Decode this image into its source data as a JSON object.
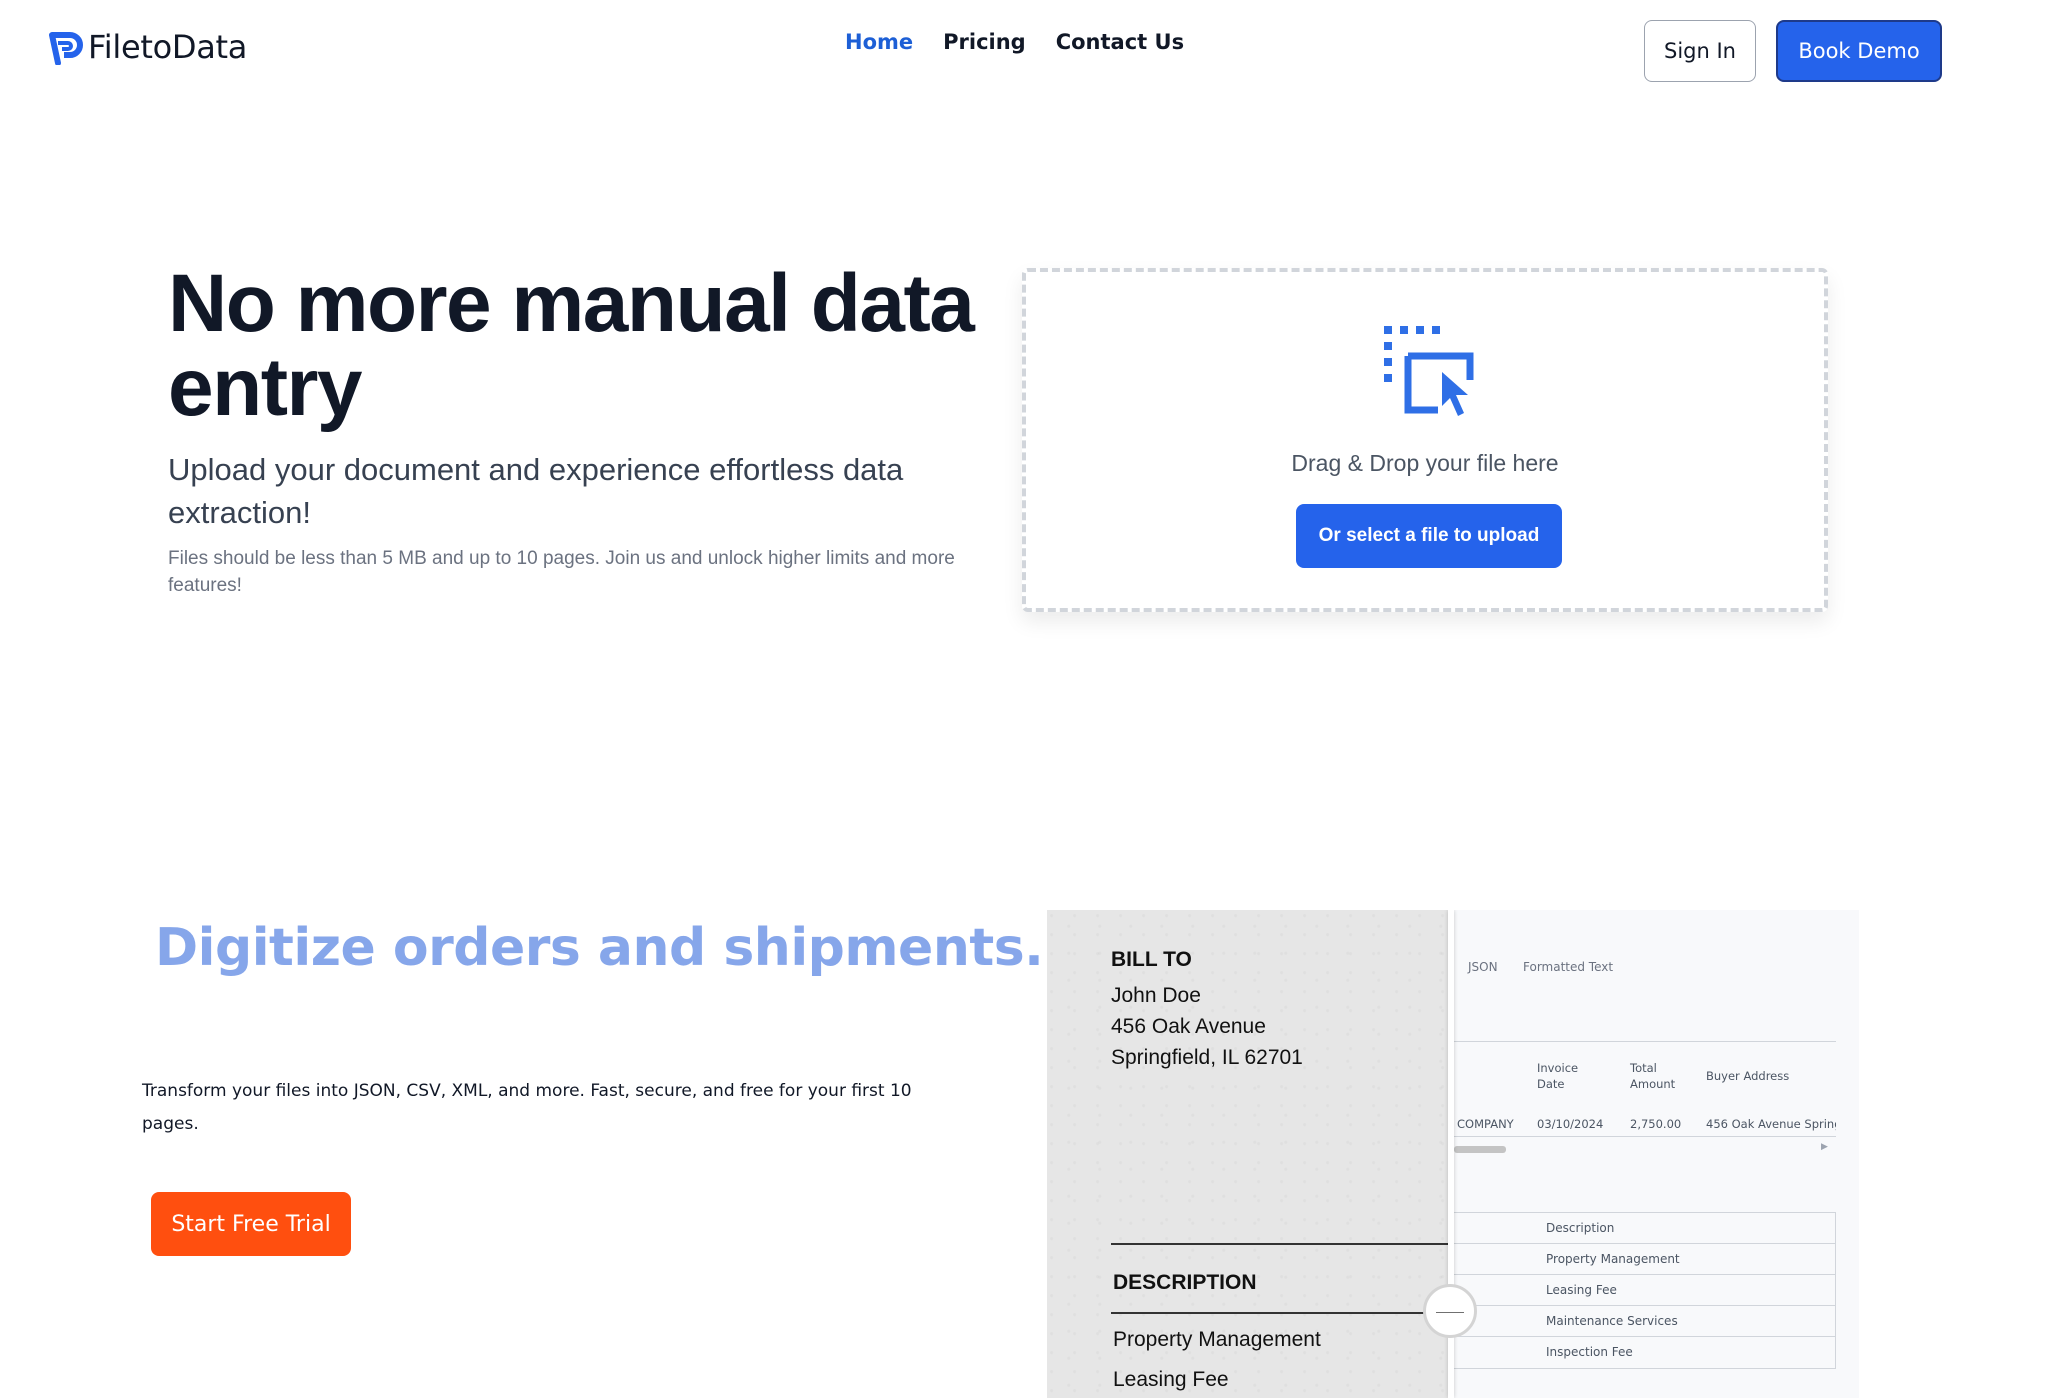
{
  "header": {
    "logo_text": "FiletoData",
    "nav": [
      {
        "label": "Home",
        "active": true
      },
      {
        "label": "Pricing",
        "active": false
      },
      {
        "label": "Contact Us",
        "active": false
      }
    ],
    "signin_label": "Sign In",
    "demo_label": "Book Demo"
  },
  "hero": {
    "title": "No more manual data entry",
    "subtitle": "Upload your document and experience effortless data extraction!",
    "note": "Files should be less than 5 MB and up to 10 pages. Join us and unlock higher limits and more features!",
    "drop_text": "Drag & Drop your file here",
    "upload_button": "Or select a file to upload",
    "drop_icon": "select-cursor-icon"
  },
  "digitize": {
    "title": "Digitize orders and shipments.",
    "description": "Transform your files into JSON, CSV, XML, and more. Fast, secure, and free for your first 10 pages.",
    "cta_label": "Start Free Trial"
  },
  "compare": {
    "paper": {
      "bill_to": "BILL TO",
      "lines": [
        "John Doe",
        "456 Oak Avenue",
        "Springfield, IL 62701"
      ],
      "description_heading": "DESCRIPTION",
      "items": [
        "Property Management",
        "Leasing Fee"
      ]
    },
    "data": {
      "tabs": [
        "JSON",
        "Formatted Text"
      ],
      "columns": [
        "Invoice Date",
        "Total Amount",
        "Buyer Address"
      ],
      "row": [
        "COMPANY",
        "03/10/2024",
        "2,750.00",
        "456 Oak Avenue Spring"
      ],
      "descriptions": [
        "Description",
        "Property Management",
        "Leasing Fee",
        "Maintenance Services",
        "Inspection Fee"
      ]
    }
  },
  "colors": {
    "primary": "#2563eb",
    "nav_active": "#1d5fd6",
    "cta_orange": "#ff4f0f",
    "digitize_title": "#86a6ea"
  }
}
